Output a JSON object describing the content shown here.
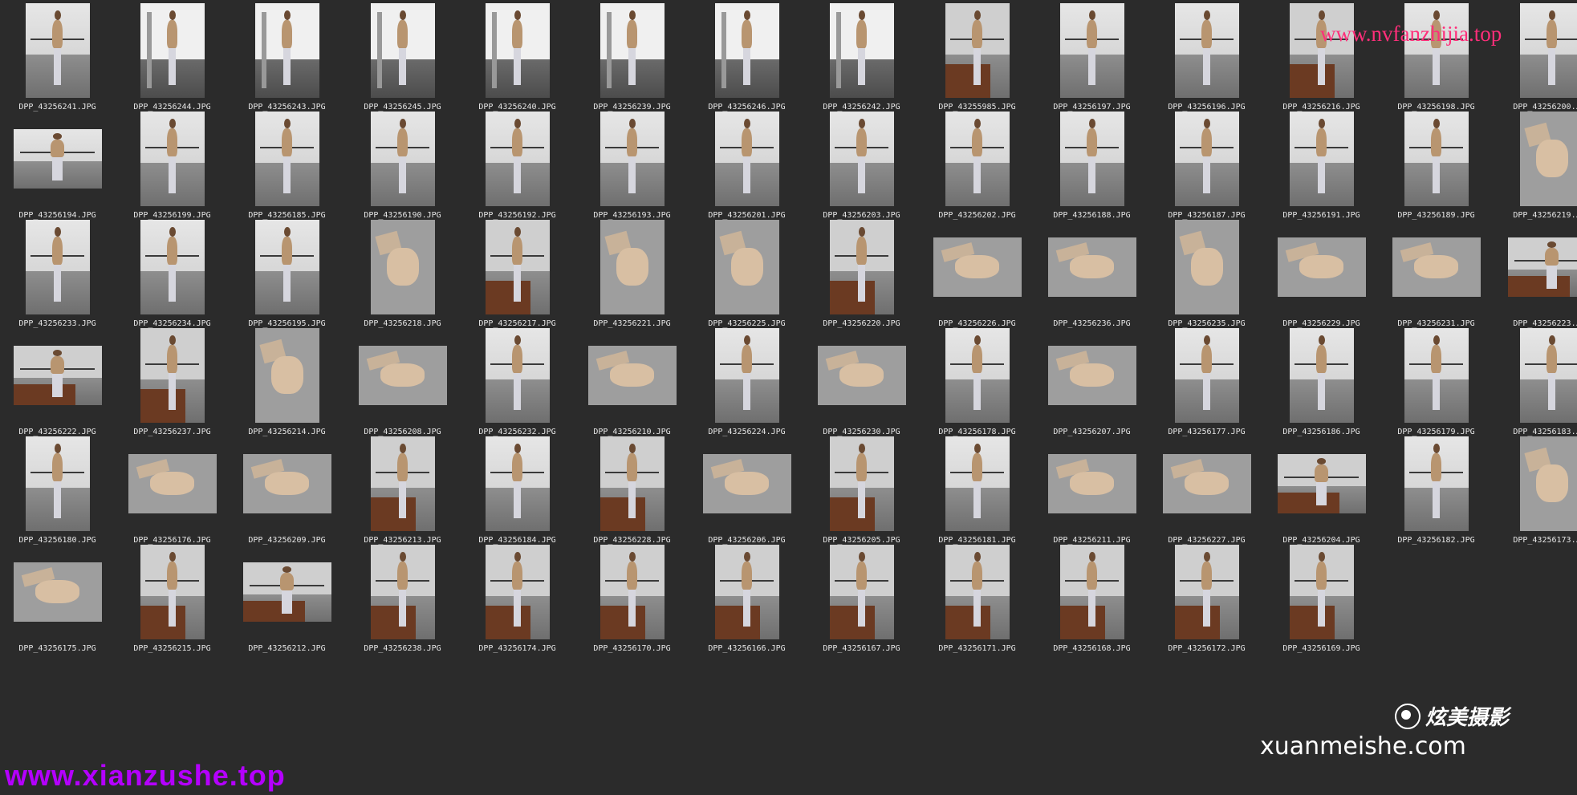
{
  "files": [
    [
      "DPP_43256241.JPG",
      "DPP_43256244.JPG",
      "DPP_43256243.JPG",
      "DPP_43256245.JPG",
      "DPP_43256240.JPG",
      "DPP_43256239.JPG",
      "DPP_43256246.JPG",
      "DPP_43256242.JPG",
      "DPP_43255985.JPG",
      "DPP_43256197.JPG",
      "DPP_43256196.JPG",
      "DPP_43256216.JPG",
      "DPP_43256198.JPG",
      "DPP_43256200.JPG"
    ],
    [
      "DPP_43256194.JPG",
      "DPP_43256199.JPG",
      "DPP_43256185.JPG",
      "DPP_43256190.JPG",
      "DPP_43256192.JPG",
      "DPP_43256193.JPG",
      "DPP_43256201.JPG",
      "DPP_43256203.JPG",
      "DPP_43256202.JPG",
      "DPP_43256188.JPG",
      "DPP_43256187.JPG",
      "DPP_43256191.JPG",
      "DPP_43256189.JPG",
      "DPP_43256219.JPG"
    ],
    [
      "DPP_43256233.JPG",
      "DPP_43256234.JPG",
      "DPP_43256195.JPG",
      "DPP_43256218.JPG",
      "DPP_43256217.JPG",
      "DPP_43256221.JPG",
      "DPP_43256225.JPG",
      "DPP_43256220.JPG",
      "DPP_43256226.JPG",
      "DPP_43256236.JPG",
      "DPP_43256235.JPG",
      "DPP_43256229.JPG",
      "DPP_43256231.JPG",
      "DPP_43256223.JPG"
    ],
    [
      "DPP_43256222.JPG",
      "DPP_43256237.JPG",
      "DPP_43256214.JPG",
      "DPP_43256208.JPG",
      "DPP_43256232.JPG",
      "DPP_43256210.JPG",
      "DPP_43256224.JPG",
      "DPP_43256230.JPG",
      "DPP_43256178.JPG",
      "DPP_43256207.JPG",
      "DPP_43256177.JPG",
      "DPP_43256186.JPG",
      "DPP_43256179.JPG",
      "DPP_43256183.JPG"
    ],
    [
      "DPP_43256180.JPG",
      "DPP_43256176.JPG",
      "DPP_43256209.JPG",
      "DPP_43256213.JPG",
      "DPP_43256184.JPG",
      "DPP_43256228.JPG",
      "DPP_43256206.JPG",
      "DPP_43256205.JPG",
      "DPP_43256181.JPG",
      "DPP_43256211.JPG",
      "DPP_43256227.JPG",
      "DPP_43256204.JPG",
      "DPP_43256182.JPG",
      "DPP_43256173.JPG"
    ],
    [
      "DPP_43256175.JPG",
      "DPP_43256215.JPG",
      "DPP_43256212.JPG",
      "DPP_43256238.JPG",
      "DPP_43256174.JPG",
      "DPP_43256170.JPG",
      "DPP_43256166.JPG",
      "DPP_43256167.JPG",
      "DPP_43256171.JPG",
      "DPP_43256168.JPG",
      "DPP_43256172.JPG",
      "DPP_43256169.JPG"
    ]
  ],
  "orientations": [
    [
      "p",
      "p",
      "p",
      "p",
      "p",
      "p",
      "p",
      "p",
      "p",
      "p",
      "p",
      "p",
      "p",
      "p"
    ],
    [
      "l",
      "p",
      "p",
      "p",
      "p",
      "p",
      "p",
      "p",
      "p",
      "p",
      "p",
      "p",
      "p",
      "p"
    ],
    [
      "p",
      "p",
      "p",
      "p",
      "p",
      "p",
      "p",
      "p",
      "l",
      "l",
      "p",
      "l",
      "l",
      "l"
    ],
    [
      "l",
      "p",
      "p",
      "l",
      "p",
      "l",
      "p",
      "l",
      "p",
      "l",
      "p",
      "p",
      "p",
      "p"
    ],
    [
      "p",
      "l",
      "l",
      "p",
      "p",
      "p",
      "l",
      "p",
      "p",
      "l",
      "l",
      "l",
      "p",
      "p"
    ],
    [
      "l",
      "p",
      "l",
      "p",
      "p",
      "p",
      "p",
      "p",
      "p",
      "p",
      "p",
      "p"
    ]
  ],
  "scenes": [
    [
      "studio",
      "stair",
      "stair",
      "stair",
      "stair",
      "stair",
      "stair",
      "stair",
      "bench",
      "studio",
      "studio",
      "bench",
      "studio",
      "studio"
    ],
    [
      "studio",
      "studio",
      "studio",
      "studio",
      "studio",
      "studio",
      "studio",
      "studio",
      "studio",
      "studio",
      "studio",
      "studio",
      "studio",
      "foot"
    ],
    [
      "studio",
      "studio",
      "studio",
      "foot",
      "bench",
      "foot",
      "foot",
      "bench",
      "foot",
      "foot",
      "foot",
      "foot",
      "foot",
      "bench"
    ],
    [
      "bench",
      "bench",
      "foot",
      "foot",
      "studio",
      "foot",
      "studio",
      "foot",
      "studio",
      "foot",
      "studio",
      "studio",
      "studio",
      "studio"
    ],
    [
      "studio",
      "foot",
      "foot",
      "bench",
      "studio",
      "bench",
      "foot",
      "bench",
      "studio",
      "foot",
      "foot",
      "bench",
      "studio",
      "foot"
    ],
    [
      "foot",
      "bench",
      "bench",
      "bench",
      "bench",
      "bench",
      "bench",
      "bench",
      "bench",
      "bench",
      "bench",
      "bench"
    ]
  ],
  "watermarks": {
    "top_right": "www.nvfanzhijia.top",
    "bottom_left": "www.xianzushe.top",
    "brand_cn": "炫美摄影",
    "brand_url": "xuanmeishe.com"
  },
  "colors": {
    "background": "#2b2b2b",
    "label_text": "#e6e6e6",
    "watermark_pink": "#ff2e7a",
    "watermark_purple": "#b400ff"
  }
}
